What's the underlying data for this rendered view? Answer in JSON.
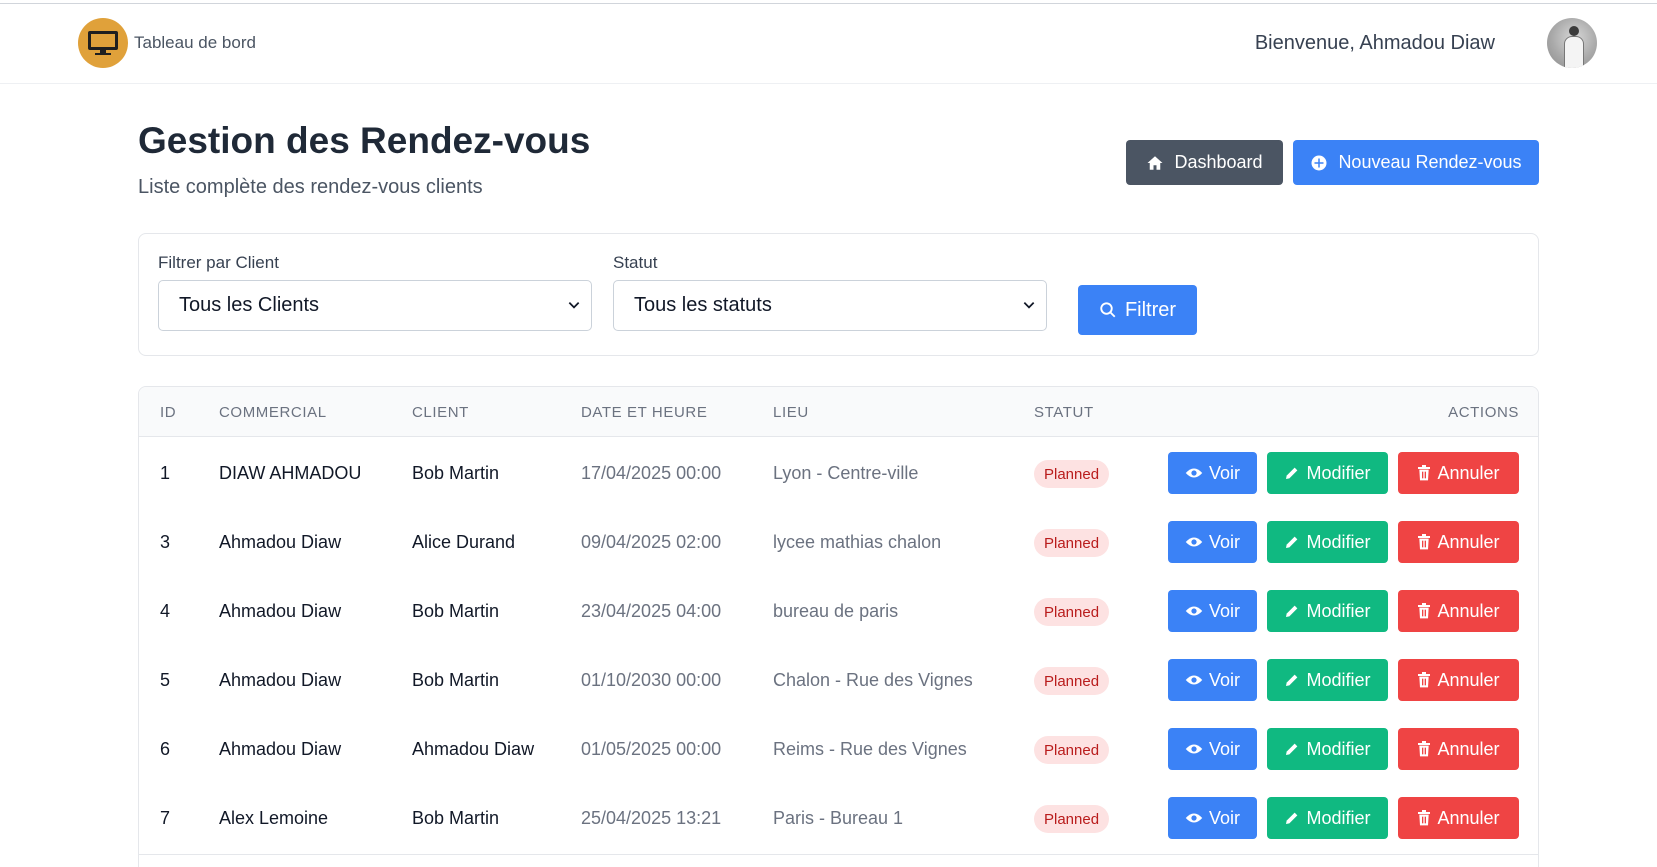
{
  "navbar": {
    "brand_text": "Tableau de bord",
    "welcome": "Bienvenue, Ahmadou Diaw"
  },
  "header": {
    "title": "Gestion des Rendez-vous",
    "subtitle": "Liste complète des rendez-vous clients",
    "dashboard_label": "Dashboard",
    "new_label": "Nouveau Rendez-vous"
  },
  "filters": {
    "client_label": "Filtrer par Client",
    "client_value": "Tous les Clients",
    "status_label": "Statut",
    "status_value": "Tous les statuts",
    "filter_button": "Filtrer"
  },
  "table": {
    "headers": {
      "id": "ID",
      "commercial": "COMMERCIAL",
      "client": "CLIENT",
      "date": "DATE ET HEURE",
      "lieu": "LIEU",
      "statut": "STATUT",
      "actions": "ACTIONS"
    },
    "rows": [
      {
        "id": "1",
        "commercial": "DIAW AHMADOU",
        "client": "Bob Martin",
        "date": "17/04/2025 00:00",
        "lieu": "Lyon - Centre-ville",
        "statut": "Planned"
      },
      {
        "id": "3",
        "commercial": "Ahmadou Diaw",
        "client": "Alice Durand",
        "date": "09/04/2025 02:00",
        "lieu": "lycee mathias chalon",
        "statut": "Planned"
      },
      {
        "id": "4",
        "commercial": "Ahmadou Diaw",
        "client": "Bob Martin",
        "date": "23/04/2025 04:00",
        "lieu": "bureau de paris",
        "statut": "Planned"
      },
      {
        "id": "5",
        "commercial": "Ahmadou Diaw",
        "client": "Bob Martin",
        "date": "01/10/2030 00:00",
        "lieu": "Chalon - Rue des Vignes",
        "statut": "Planned"
      },
      {
        "id": "6",
        "commercial": "Ahmadou Diaw",
        "client": "Ahmadou Diaw",
        "date": "01/05/2025 00:00",
        "lieu": "Reims - Rue des Vignes",
        "statut": "Planned"
      },
      {
        "id": "7",
        "commercial": "Alex Lemoine",
        "client": "Bob Martin",
        "date": "25/04/2025 13:21",
        "lieu": "Paris - Bureau 1",
        "statut": "Planned"
      }
    ],
    "actions": {
      "view": "Voir",
      "edit": "Modifier",
      "cancel": "Annuler"
    }
  },
  "colors": {
    "primary": "#3b82f6",
    "secondary": "#4b5563",
    "success": "#10b981",
    "danger": "#ef4444",
    "badge_bg": "#fde2e2",
    "badge_text": "#b91c1c",
    "logo": "#e0a13a"
  },
  "icons": {
    "home": "home-icon",
    "add": "plus-circle-icon",
    "search": "search-icon",
    "view": "eye-icon",
    "edit": "pencil-icon",
    "delete": "trash-icon",
    "select": "chevron-down-icon"
  }
}
